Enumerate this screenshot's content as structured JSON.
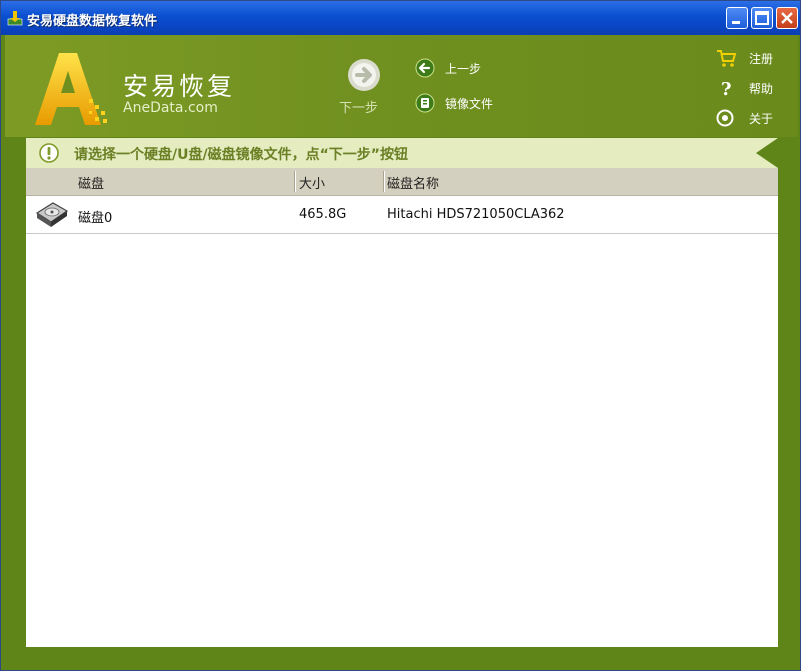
{
  "window": {
    "title": "安易硬盘数据恢复软件"
  },
  "brand": {
    "name": "安易恢复",
    "site": "AneData.com"
  },
  "toolbar": {
    "next_label": "下一步",
    "prev_label": "上一步",
    "image_file_label": "镜像文件"
  },
  "side_menu": {
    "register": "注册",
    "help": "帮助",
    "about": "关于"
  },
  "hint": {
    "text": "请选择一个硬盘/U盘/磁盘镜像文件，点“下一步”按钮"
  },
  "table": {
    "columns": [
      "磁盘",
      "大小",
      "磁盘名称"
    ],
    "rows": [
      {
        "disk": "磁盘0",
        "size": "465.8G",
        "name": "Hitachi HDS721050CLA362"
      }
    ]
  },
  "colors": {
    "frame_green": "#5f8417",
    "header_green": "#6f8f1f",
    "hint_bg": "#e4ecc0",
    "titlebar_blue": "#0a4fd0"
  },
  "icons": {
    "app": "app-icon",
    "minimize": "minimize-icon",
    "maximize": "maximize-icon",
    "close": "close-icon",
    "next": "arrow-right-circle-icon",
    "prev": "arrow-left-circle-icon",
    "image_file": "disk-image-icon",
    "register": "cart-icon",
    "help": "question-icon",
    "about": "info-circle-icon",
    "hint": "exclamation-circle-icon",
    "disk": "hard-disk-icon"
  }
}
